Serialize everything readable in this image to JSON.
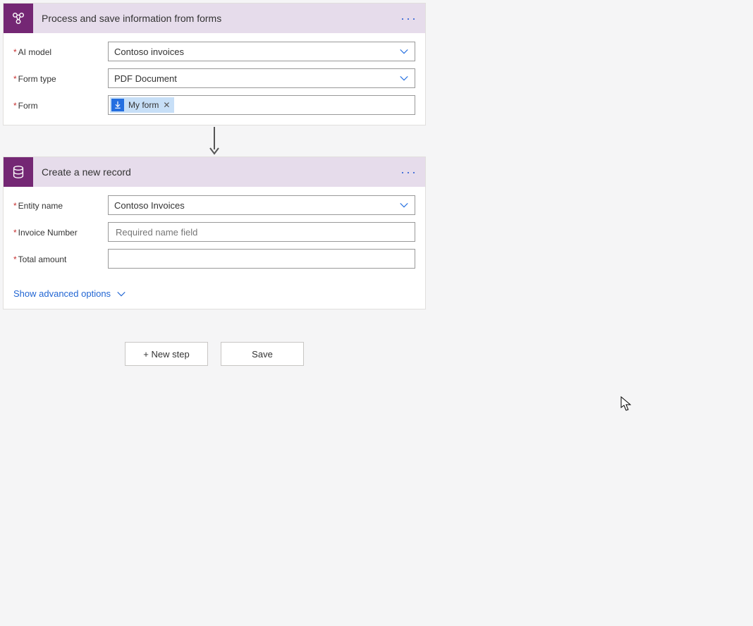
{
  "step1": {
    "title": "Process and save information from forms",
    "fields": {
      "ai_model": {
        "label": "AI model",
        "value": "Contoso invoices"
      },
      "form_type": {
        "label": "Form type",
        "value": "PDF Document"
      },
      "form": {
        "label": "Form",
        "token": "My form"
      }
    }
  },
  "step2": {
    "title": "Create a new record",
    "fields": {
      "entity": {
        "label": "Entity name",
        "value": "Contoso Invoices"
      },
      "invoice_number": {
        "label": "Invoice Number",
        "placeholder": "Required name field"
      },
      "total_amount": {
        "label": "Total amount",
        "placeholder": ""
      }
    },
    "advanced": "Show advanced options"
  },
  "buttons": {
    "new_step": "+ New step",
    "save": "Save"
  }
}
